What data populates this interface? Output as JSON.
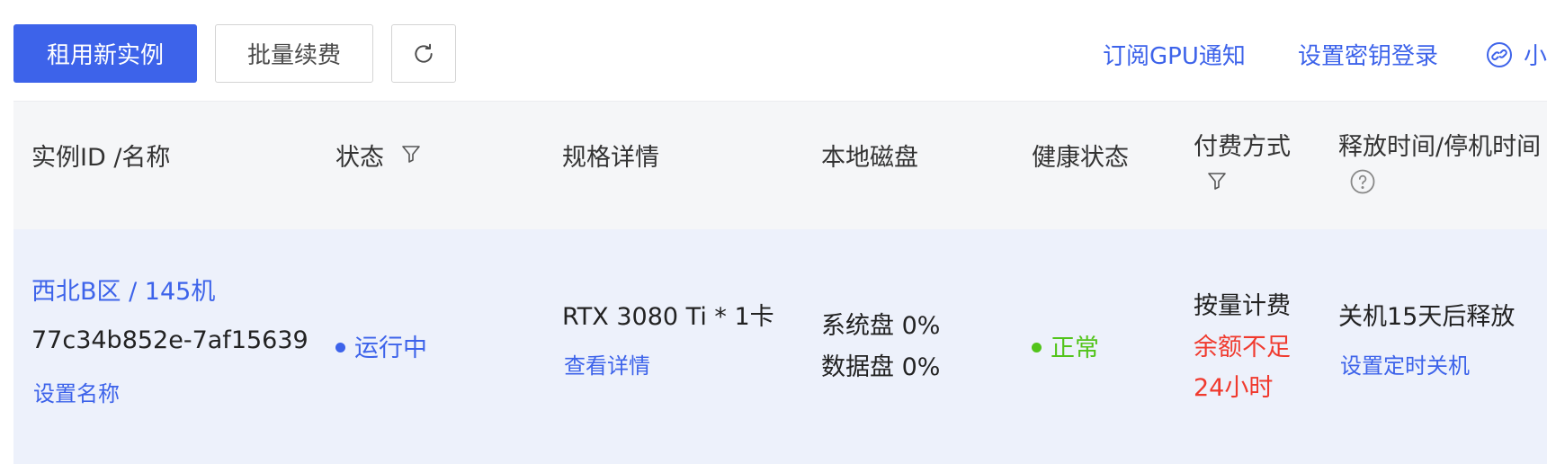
{
  "toolbar": {
    "rent_button": "租用新实例",
    "renew_button": "批量续费",
    "refresh_icon": "refresh-icon",
    "subscribe_link": "订阅GPU通知",
    "ssh_key_link": "设置密钥登录",
    "help_link": "小",
    "help_icon": "link-icon"
  },
  "table": {
    "headers": {
      "instance": "实例ID /名称",
      "status": "状态",
      "spec": "规格详情",
      "disk": "本地磁盘",
      "health": "健康状态",
      "billing": "付费方式",
      "release": "释放时间/停机时间"
    },
    "rows": [
      {
        "region_name": "西北B区 / 145机",
        "instance_id": "77c34b852e-7af15639",
        "set_name": "设置名称",
        "status": "运行中",
        "spec": "RTX 3080 Ti * 1卡",
        "spec_detail": "查看详情",
        "system_disk": "系统盘 0%",
        "data_disk": "数据盘 0%",
        "health": "正常",
        "billing": "按量计费",
        "billing_warning_1": "余额不足",
        "billing_warning_2": "24小时",
        "release": "关机15天后释放",
        "schedule": "设置定时关机"
      }
    ]
  },
  "colors": {
    "primary": "#3d63ea",
    "warning": "#f03a2e",
    "success": "#52c41a",
    "header_bg": "#f5f6f8",
    "row_bg": "#edf1fb"
  }
}
